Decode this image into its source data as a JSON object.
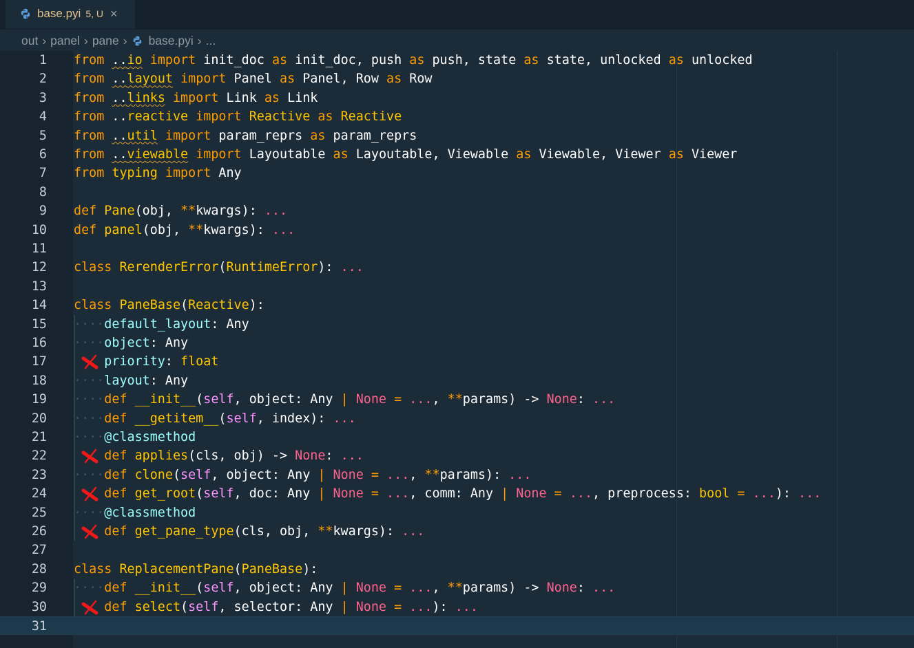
{
  "tab": {
    "filename": "base.pyi",
    "status": "5, U",
    "close": "×"
  },
  "breadcrumb": [
    "out",
    "panel",
    "pane",
    "base.pyi",
    "..."
  ],
  "breakpoint_lines": [
    17,
    22,
    24,
    26,
    30
  ],
  "current_line": 31,
  "code_lines": [
    [
      [
        "kw",
        "from"
      ],
      [
        "p",
        " "
      ],
      [
        "wv",
        ".."
      ],
      [
        "wvm",
        "io"
      ],
      [
        "p",
        " "
      ],
      [
        "kw",
        "import"
      ],
      [
        "p",
        " init_doc "
      ],
      [
        "kw",
        "as"
      ],
      [
        "p",
        " init_doc, push "
      ],
      [
        "kw",
        "as"
      ],
      [
        "p",
        " push, state "
      ],
      [
        "kw",
        "as"
      ],
      [
        "p",
        " state, unlocked "
      ],
      [
        "kw",
        "as"
      ],
      [
        "p",
        " unlocked"
      ]
    ],
    [
      [
        "kw",
        "from"
      ],
      [
        "p",
        " "
      ],
      [
        "wv",
        ".."
      ],
      [
        "wvm",
        "layout"
      ],
      [
        "p",
        " "
      ],
      [
        "kw",
        "import"
      ],
      [
        "p",
        " Panel "
      ],
      [
        "kw",
        "as"
      ],
      [
        "p",
        " Panel, Row "
      ],
      [
        "kw",
        "as"
      ],
      [
        "p",
        " Row"
      ]
    ],
    [
      [
        "kw",
        "from"
      ],
      [
        "p",
        " "
      ],
      [
        "wv",
        ".."
      ],
      [
        "wvm",
        "links"
      ],
      [
        "p",
        " "
      ],
      [
        "kw",
        "import"
      ],
      [
        "p",
        " Link "
      ],
      [
        "kw",
        "as"
      ],
      [
        "p",
        " Link"
      ]
    ],
    [
      [
        "kw",
        "from"
      ],
      [
        "p",
        " .."
      ],
      [
        "mod",
        "reactive"
      ],
      [
        "p",
        " "
      ],
      [
        "kw",
        "import"
      ],
      [
        "p",
        " "
      ],
      [
        "cls",
        "Reactive"
      ],
      [
        "p",
        " "
      ],
      [
        "kw",
        "as"
      ],
      [
        "p",
        " "
      ],
      [
        "cls",
        "Reactive"
      ]
    ],
    [
      [
        "kw",
        "from"
      ],
      [
        "p",
        " "
      ],
      [
        "wv",
        ".."
      ],
      [
        "wvm",
        "util"
      ],
      [
        "p",
        " "
      ],
      [
        "kw",
        "import"
      ],
      [
        "p",
        " param_reprs "
      ],
      [
        "kw",
        "as"
      ],
      [
        "p",
        " param_reprs"
      ]
    ],
    [
      [
        "kw",
        "from"
      ],
      [
        "p",
        " "
      ],
      [
        "wv",
        ".."
      ],
      [
        "wvm",
        "viewable"
      ],
      [
        "p",
        " "
      ],
      [
        "kw",
        "import"
      ],
      [
        "p",
        " Layoutable "
      ],
      [
        "kw",
        "as"
      ],
      [
        "p",
        " Layoutable, Viewable "
      ],
      [
        "kw",
        "as"
      ],
      [
        "p",
        " Viewable, Viewer "
      ],
      [
        "kw",
        "as"
      ],
      [
        "p",
        " Viewer"
      ]
    ],
    [
      [
        "kw",
        "from"
      ],
      [
        "p",
        " "
      ],
      [
        "mod",
        "typing"
      ],
      [
        "p",
        " "
      ],
      [
        "kw",
        "import"
      ],
      [
        "p",
        " Any"
      ]
    ],
    [],
    [
      [
        "kw",
        "def"
      ],
      [
        "p",
        " "
      ],
      [
        "fn",
        "Pane"
      ],
      [
        "p",
        "(obj, "
      ],
      [
        "op",
        "**"
      ],
      [
        "p",
        "kwargs): "
      ],
      [
        "ell",
        "..."
      ]
    ],
    [
      [
        "kw",
        "def"
      ],
      [
        "p",
        " "
      ],
      [
        "fn",
        "panel"
      ],
      [
        "p",
        "(obj, "
      ],
      [
        "op",
        "**"
      ],
      [
        "p",
        "kwargs): "
      ],
      [
        "ell",
        "..."
      ]
    ],
    [],
    [
      [
        "kw",
        "class"
      ],
      [
        "p",
        " "
      ],
      [
        "cls",
        "RerenderError"
      ],
      [
        "p",
        "("
      ],
      [
        "cls",
        "RuntimeError"
      ],
      [
        "p",
        "): "
      ],
      [
        "ell",
        "..."
      ]
    ],
    [],
    [
      [
        "kw",
        "class"
      ],
      [
        "p",
        " "
      ],
      [
        "cls",
        "PaneBase"
      ],
      [
        "p",
        "("
      ],
      [
        "cls",
        "Reactive"
      ],
      [
        "p",
        "):"
      ]
    ],
    [
      [
        "dots",
        "····"
      ],
      [
        "attr",
        "default_layout"
      ],
      [
        "p",
        ": Any"
      ]
    ],
    [
      [
        "dots",
        "····"
      ],
      [
        "attr",
        "object"
      ],
      [
        "p",
        ": Any"
      ]
    ],
    [
      [
        "dots",
        "    "
      ],
      [
        "attr",
        "priority"
      ],
      [
        "p",
        ": "
      ],
      [
        "type",
        "float"
      ]
    ],
    [
      [
        "dots",
        "····"
      ],
      [
        "attr",
        "layout"
      ],
      [
        "p",
        ": Any"
      ]
    ],
    [
      [
        "dots",
        "····"
      ],
      [
        "kw",
        "def"
      ],
      [
        "p",
        " "
      ],
      [
        "fn",
        "__init__"
      ],
      [
        "p",
        "("
      ],
      [
        "self",
        "self"
      ],
      [
        "p",
        ", object: Any "
      ],
      [
        "op",
        "|"
      ],
      [
        "p",
        " "
      ],
      [
        "none",
        "None"
      ],
      [
        "p",
        " "
      ],
      [
        "op",
        "="
      ],
      [
        "p",
        " "
      ],
      [
        "ell",
        "..."
      ],
      [
        "p",
        ", "
      ],
      [
        "op",
        "**"
      ],
      [
        "p",
        "params) "
      ],
      [
        "p",
        "-> "
      ],
      [
        "none",
        "None"
      ],
      [
        "p",
        ": "
      ],
      [
        "ell",
        "..."
      ]
    ],
    [
      [
        "dots",
        "····"
      ],
      [
        "kw",
        "def"
      ],
      [
        "p",
        " "
      ],
      [
        "fn",
        "__getitem__"
      ],
      [
        "p",
        "("
      ],
      [
        "self",
        "self"
      ],
      [
        "p",
        ", index): "
      ],
      [
        "ell",
        "..."
      ]
    ],
    [
      [
        "dots",
        "····"
      ],
      [
        "deco",
        "@classmethod"
      ]
    ],
    [
      [
        "dots",
        "    "
      ],
      [
        "kw",
        "def"
      ],
      [
        "p",
        " "
      ],
      [
        "fn",
        "applies"
      ],
      [
        "p",
        "(cls, obj) -> "
      ],
      [
        "none",
        "None"
      ],
      [
        "p",
        ": "
      ],
      [
        "ell",
        "..."
      ]
    ],
    [
      [
        "dots",
        "····"
      ],
      [
        "kw",
        "def"
      ],
      [
        "p",
        " "
      ],
      [
        "fn",
        "clone"
      ],
      [
        "p",
        "("
      ],
      [
        "self",
        "self"
      ],
      [
        "p",
        ", object: Any "
      ],
      [
        "op",
        "|"
      ],
      [
        "p",
        " "
      ],
      [
        "none",
        "None"
      ],
      [
        "p",
        " "
      ],
      [
        "op",
        "="
      ],
      [
        "p",
        " "
      ],
      [
        "ell",
        "..."
      ],
      [
        "p",
        ", "
      ],
      [
        "op",
        "**"
      ],
      [
        "p",
        "params): "
      ],
      [
        "ell",
        "..."
      ]
    ],
    [
      [
        "dots",
        "    "
      ],
      [
        "kw",
        "def"
      ],
      [
        "p",
        " "
      ],
      [
        "fn",
        "get_root"
      ],
      [
        "p",
        "("
      ],
      [
        "self",
        "self"
      ],
      [
        "p",
        ", doc: Any "
      ],
      [
        "op",
        "|"
      ],
      [
        "p",
        " "
      ],
      [
        "none",
        "None"
      ],
      [
        "p",
        " "
      ],
      [
        "op",
        "="
      ],
      [
        "p",
        " "
      ],
      [
        "ell",
        "..."
      ],
      [
        "p",
        ", comm: Any "
      ],
      [
        "op",
        "|"
      ],
      [
        "p",
        " "
      ],
      [
        "none",
        "None"
      ],
      [
        "p",
        " "
      ],
      [
        "op",
        "="
      ],
      [
        "p",
        " "
      ],
      [
        "ell",
        "..."
      ],
      [
        "p",
        ", preprocess: "
      ],
      [
        "type",
        "bool"
      ],
      [
        "p",
        " "
      ],
      [
        "op",
        "="
      ],
      [
        "p",
        " "
      ],
      [
        "ell",
        "..."
      ],
      [
        "p",
        "): "
      ],
      [
        "ell",
        "..."
      ]
    ],
    [
      [
        "dots",
        "····"
      ],
      [
        "deco",
        "@classmethod"
      ]
    ],
    [
      [
        "dots",
        "    "
      ],
      [
        "kw",
        "def"
      ],
      [
        "p",
        " "
      ],
      [
        "fn",
        "get_pane_type"
      ],
      [
        "p",
        "(cls, obj, "
      ],
      [
        "op",
        "**"
      ],
      [
        "p",
        "kwargs): "
      ],
      [
        "ell",
        "..."
      ]
    ],
    [],
    [
      [
        "kw",
        "class"
      ],
      [
        "p",
        " "
      ],
      [
        "cls",
        "ReplacementPane"
      ],
      [
        "p",
        "("
      ],
      [
        "cls",
        "PaneBase"
      ],
      [
        "p",
        "):"
      ]
    ],
    [
      [
        "dots",
        "····"
      ],
      [
        "kw",
        "def"
      ],
      [
        "p",
        " "
      ],
      [
        "fn",
        "__init__"
      ],
      [
        "p",
        "("
      ],
      [
        "self",
        "self"
      ],
      [
        "p",
        ", object: Any "
      ],
      [
        "op",
        "|"
      ],
      [
        "p",
        " "
      ],
      [
        "none",
        "None"
      ],
      [
        "p",
        " "
      ],
      [
        "op",
        "="
      ],
      [
        "p",
        " "
      ],
      [
        "ell",
        "..."
      ],
      [
        "p",
        ", "
      ],
      [
        "op",
        "**"
      ],
      [
        "p",
        "params) "
      ],
      [
        "p",
        "-> "
      ],
      [
        "none",
        "None"
      ],
      [
        "p",
        ": "
      ],
      [
        "ell",
        "..."
      ]
    ],
    [
      [
        "dots",
        "    "
      ],
      [
        "kw",
        "def"
      ],
      [
        "p",
        " "
      ],
      [
        "fn",
        "select"
      ],
      [
        "p",
        "("
      ],
      [
        "self",
        "self"
      ],
      [
        "p",
        ", selector: Any "
      ],
      [
        "op",
        "|"
      ],
      [
        "p",
        " "
      ],
      [
        "none",
        "None"
      ],
      [
        "p",
        " "
      ],
      [
        "op",
        "="
      ],
      [
        "p",
        " "
      ],
      [
        "ell",
        "..."
      ],
      [
        "p",
        "): "
      ],
      [
        "ell",
        "..."
      ]
    ],
    []
  ]
}
